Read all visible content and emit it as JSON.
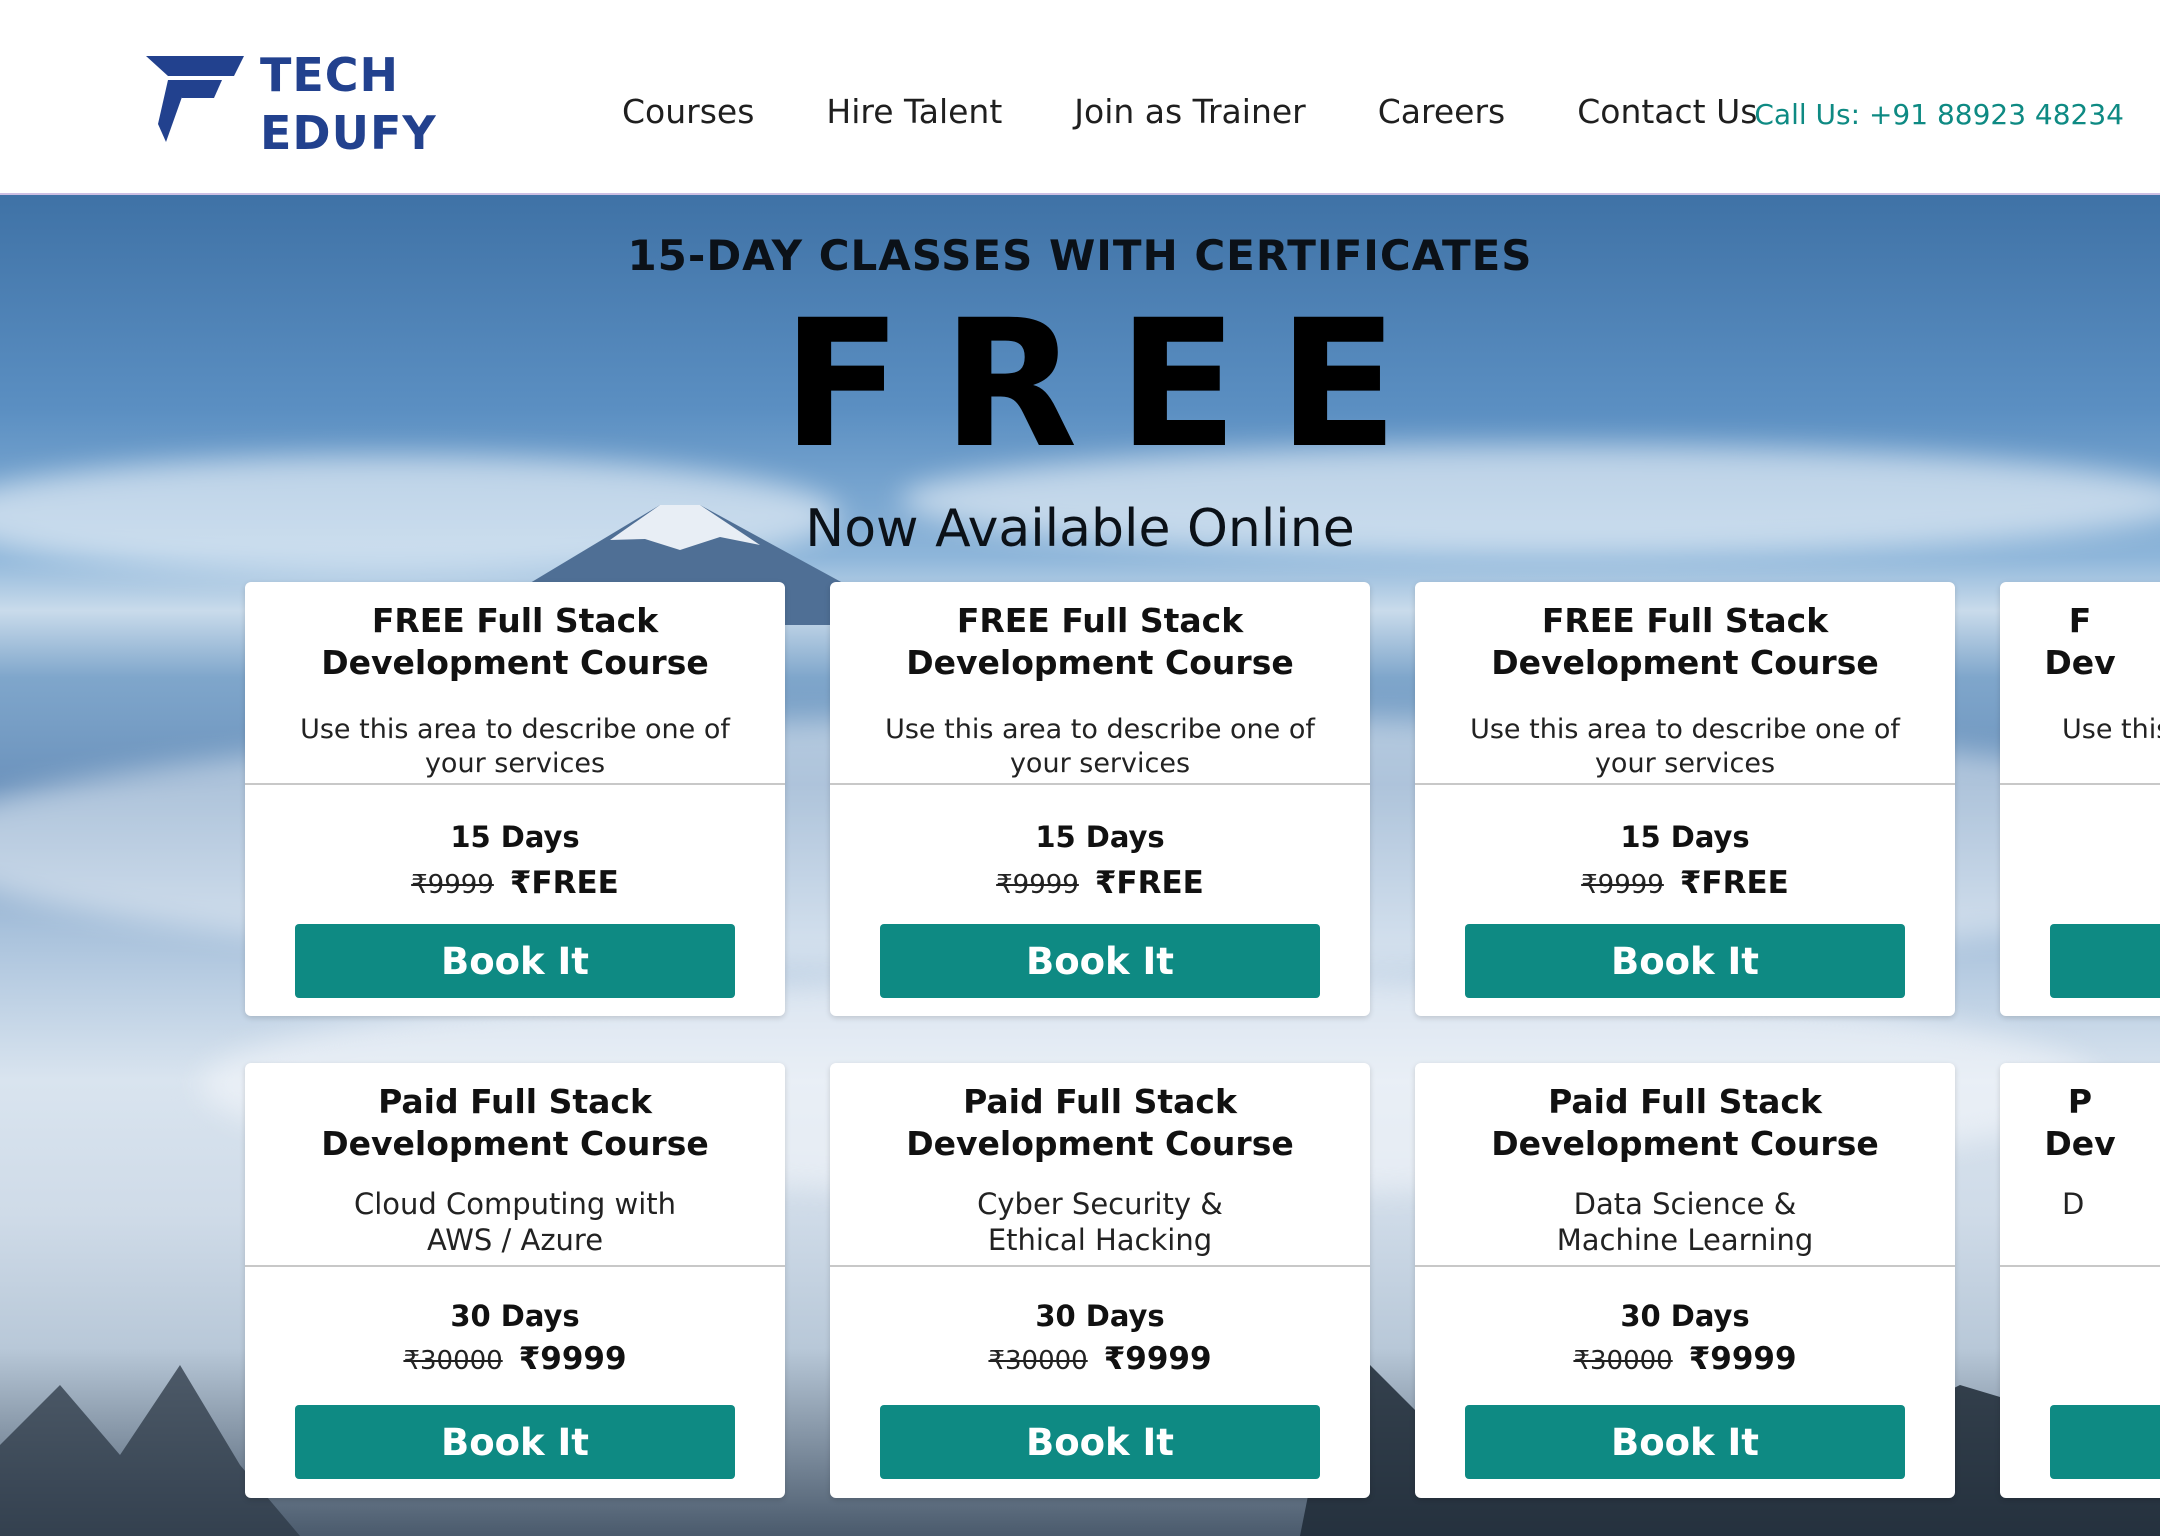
{
  "brand": {
    "logo_line1": "TECH",
    "logo_line2": "EDUFY",
    "color": "#22418e"
  },
  "nav": {
    "items": [
      "Courses",
      "Hire Talent",
      "Join as Trainer",
      "Careers",
      "Contact Us"
    ]
  },
  "header": {
    "call_text": "Call Us: +91 88923 48234"
  },
  "hero": {
    "subtitle": "15-DAY CLASSES  WITH CERTIFICATES",
    "headline": "FREE",
    "tagline": "Now Available Online"
  },
  "colors": {
    "accent": "#0e8a83",
    "text": "#111111"
  },
  "icons": {
    "logo": "tech-edufy-logo-mark"
  },
  "cards": [
    {
      "title": "FREE Full Stack\nDevelopment Course",
      "description": "Use this area to describe one of your services",
      "duration": "15 Days",
      "old_price": "₹9999",
      "new_price": "₹FREE",
      "button": "Book It"
    },
    {
      "title": "FREE Full Stack\nDevelopment Course",
      "description": "Use this area to describe one of your services",
      "duration": "15 Days",
      "old_price": "₹9999",
      "new_price": "₹FREE",
      "button": "Book It"
    },
    {
      "title": "FREE Full Stack\nDevelopment Course",
      "description": "Use this area to describe one of your services",
      "duration": "15 Days",
      "old_price": "₹9999",
      "new_price": "₹FREE",
      "button": "Book It"
    },
    {
      "title": "F\nDev",
      "description": "Use this",
      "duration": "",
      "old_price": "",
      "new_price": "",
      "button": ""
    },
    {
      "title": "Paid Full Stack\nDevelopment Course",
      "description": "Cloud Computing with\nAWS / Azure",
      "duration": "30 Days",
      "old_price": "₹30000",
      "new_price": "₹9999",
      "button": "Book It"
    },
    {
      "title": "Paid Full Stack\nDevelopment Course",
      "description": "Cyber Security &\nEthical Hacking",
      "duration": "30 Days",
      "old_price": "₹30000",
      "new_price": "₹9999",
      "button": "Book It"
    },
    {
      "title": "Paid Full Stack\nDevelopment Course",
      "description": "Data Science &\nMachine Learning",
      "duration": "30 Days",
      "old_price": "₹30000",
      "new_price": "₹9999",
      "button": "Book It"
    },
    {
      "title": "P\nDev",
      "description": "D",
      "duration": "",
      "old_price": "",
      "new_price": "",
      "button": ""
    }
  ]
}
